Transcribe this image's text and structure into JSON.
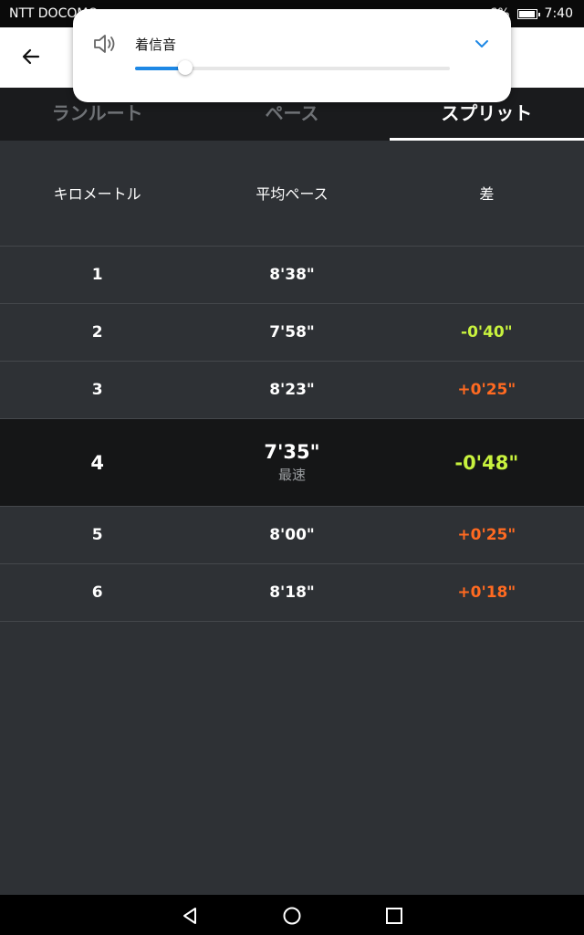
{
  "status_bar": {
    "carrier": "NTT DOCOMO",
    "battery_text": "6%",
    "time": "7:40"
  },
  "tabs": [
    {
      "label": "ランルート",
      "active": false
    },
    {
      "label": "ペース",
      "active": false
    },
    {
      "label": "スプリット",
      "active": true
    }
  ],
  "table": {
    "headers": [
      "キロメートル",
      "平均ペース",
      "差"
    ],
    "rows": [
      {
        "km": "1",
        "pace": "8'38\"",
        "diff": "",
        "diff_type": "none"
      },
      {
        "km": "2",
        "pace": "7'58\"",
        "diff": "-0'40\"",
        "diff_type": "neg"
      },
      {
        "km": "3",
        "pace": "8'23\"",
        "diff": "+0'25\"",
        "diff_type": "pos"
      },
      {
        "km": "4",
        "pace": "7'35\"",
        "note": "最速",
        "diff": "-0'48\"",
        "diff_type": "neg"
      },
      {
        "km": "5",
        "pace": "8'00\"",
        "diff": "+0'25\"",
        "diff_type": "pos"
      },
      {
        "km": "6",
        "pace": "8'18\"",
        "diff": "+0'18\"",
        "diff_type": "pos"
      }
    ]
  },
  "volume_panel": {
    "label": "着信音",
    "level": 0.16
  },
  "colors": {
    "accent": "#1e88e5",
    "faster": "#c8f23e",
    "slower": "#ff6a21"
  }
}
